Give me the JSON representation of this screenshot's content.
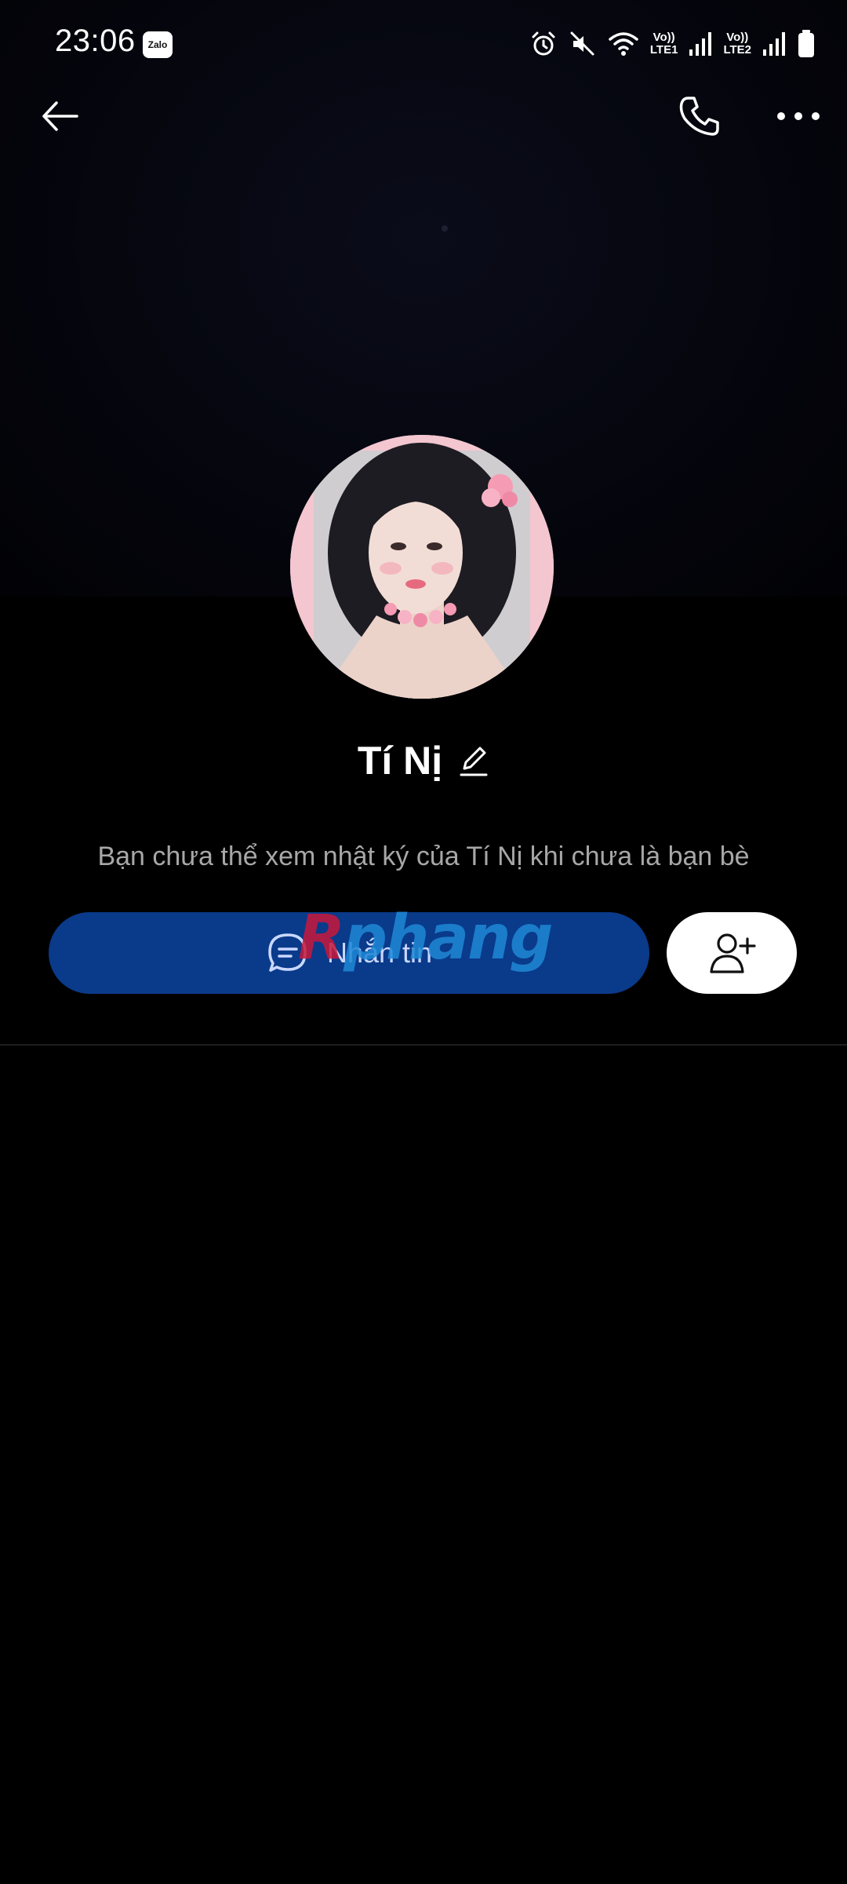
{
  "status_bar": {
    "time": "23:06",
    "app_badge": "Zalo",
    "sim1_label_top": "Vo))",
    "sim1_label_bottom": "LTE1",
    "sim2_label_top": "Vo))",
    "sim2_label_bottom": "LTE2",
    "icons": [
      "alarm-icon",
      "mute-icon",
      "wifi-icon",
      "signal-icon",
      "signal-icon",
      "battery-icon"
    ]
  },
  "top_bar": {
    "icons": [
      "back-arrow-icon",
      "phone-icon",
      "more-icon"
    ]
  },
  "profile": {
    "name": "Tí Nị",
    "notice": "Bạn chưa thể xem nhật ký của Tí Nị khi chưa là bạn bè"
  },
  "actions": {
    "message_label": "Nhắn tin",
    "message_icon": "chat-bubble-icon",
    "add_friend_icon": "add-friend-icon"
  },
  "watermark": {
    "part1": "R",
    "part2": "phang"
  },
  "colors": {
    "background": "#000000",
    "message_button": "#0a3a8a",
    "notice_text": "#a7a7a7",
    "avatar_background": "#f3c6d0"
  }
}
